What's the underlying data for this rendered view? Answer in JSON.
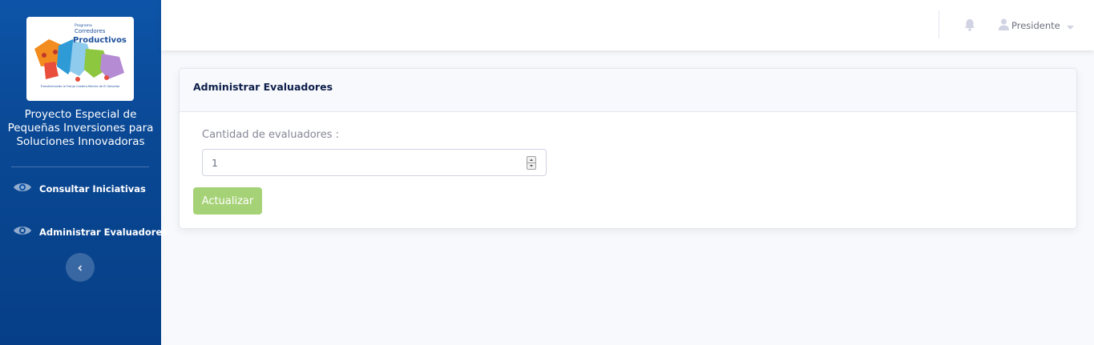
{
  "logo": {
    "line1": "Programa",
    "line2": "Corredores",
    "line3": "Productivos",
    "tagline": "Transformando la Franja Costero-Marina de El Salvador"
  },
  "sidebar": {
    "title_lines": [
      "Proyecto Especial de",
      "Pequeñas Inversiones para",
      "Soluciones Innovadoras"
    ],
    "items": [
      {
        "label": "Consultar Iniciativas",
        "icon": "eye-icon"
      },
      {
        "label": "Administrar Evaluadores",
        "icon": "eye-icon"
      }
    ],
    "collapse_icon": "chevron-left-icon"
  },
  "topbar": {
    "bell_icon": "bell-icon",
    "user_icon": "user-icon",
    "user_name": "Presidente",
    "caret_icon": "caret-down-icon"
  },
  "card": {
    "title": "Administrar Evaluadores",
    "field_label": "Cantidad de evaluadores :",
    "field_value": "1",
    "button_label": "Actualizar"
  },
  "colors": {
    "sidebar": "#0a4894",
    "button": "#a6d277",
    "card_title": "#0d1f4a"
  }
}
